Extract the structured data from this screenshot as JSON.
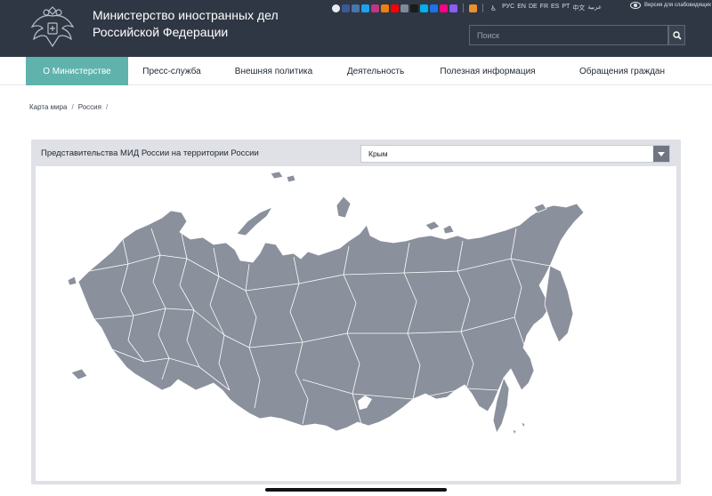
{
  "header": {
    "title_line1": "Министерство иностранных дел",
    "title_line2": "Российской Федерации",
    "languages": [
      "РУС",
      "EN",
      "DE",
      "FR",
      "ES",
      "PT",
      "中文",
      "عربية"
    ],
    "low_vision_label": "Версия для слабовидящих",
    "search_placeholder": "Поиск",
    "social_icons": [
      {
        "name": "telegram-icon",
        "color": "#e9edf3"
      },
      {
        "name": "facebook-icon",
        "color": "#3b5998"
      },
      {
        "name": "vk-icon",
        "color": "#4a76a8"
      },
      {
        "name": "twitter-icon",
        "color": "#1da1f2"
      },
      {
        "name": "instagram-icon",
        "color": "#c13584"
      },
      {
        "name": "ok-icon",
        "color": "#ee8208"
      },
      {
        "name": "youtube-icon",
        "color": "#ff0000"
      },
      {
        "name": "zen-icon",
        "color": "#7f8a99"
      },
      {
        "name": "tiktok-icon",
        "color": "#1b1b1b"
      },
      {
        "name": "livejournal-icon",
        "color": "#00b0ea"
      },
      {
        "name": "rutube-icon",
        "color": "#1a73e8"
      },
      {
        "name": "flickr-icon",
        "color": "#ff0084"
      },
      {
        "name": "yappy-icon",
        "color": "#8b5cf6"
      }
    ]
  },
  "nav": {
    "items": [
      {
        "label": "О Министерстве",
        "active": true
      },
      {
        "label": "Пресс-служба"
      },
      {
        "label": "Внешняя политика"
      },
      {
        "label": "Деятельность"
      },
      {
        "label": "Полезная информация"
      },
      {
        "label": "Обращения граждан"
      }
    ]
  },
  "breadcrumb": [
    "Карта мира",
    "Россия"
  ],
  "map_panel": {
    "title": "Представительства МИД России на территории России",
    "selected_region": "Крым",
    "map_fill_color": "#8a909c",
    "map_border_color": "#ffffff"
  },
  "colors": {
    "header_bg": "#2f3744",
    "accent": "#5fb3ac",
    "panel_bg": "#dfe1e6"
  }
}
